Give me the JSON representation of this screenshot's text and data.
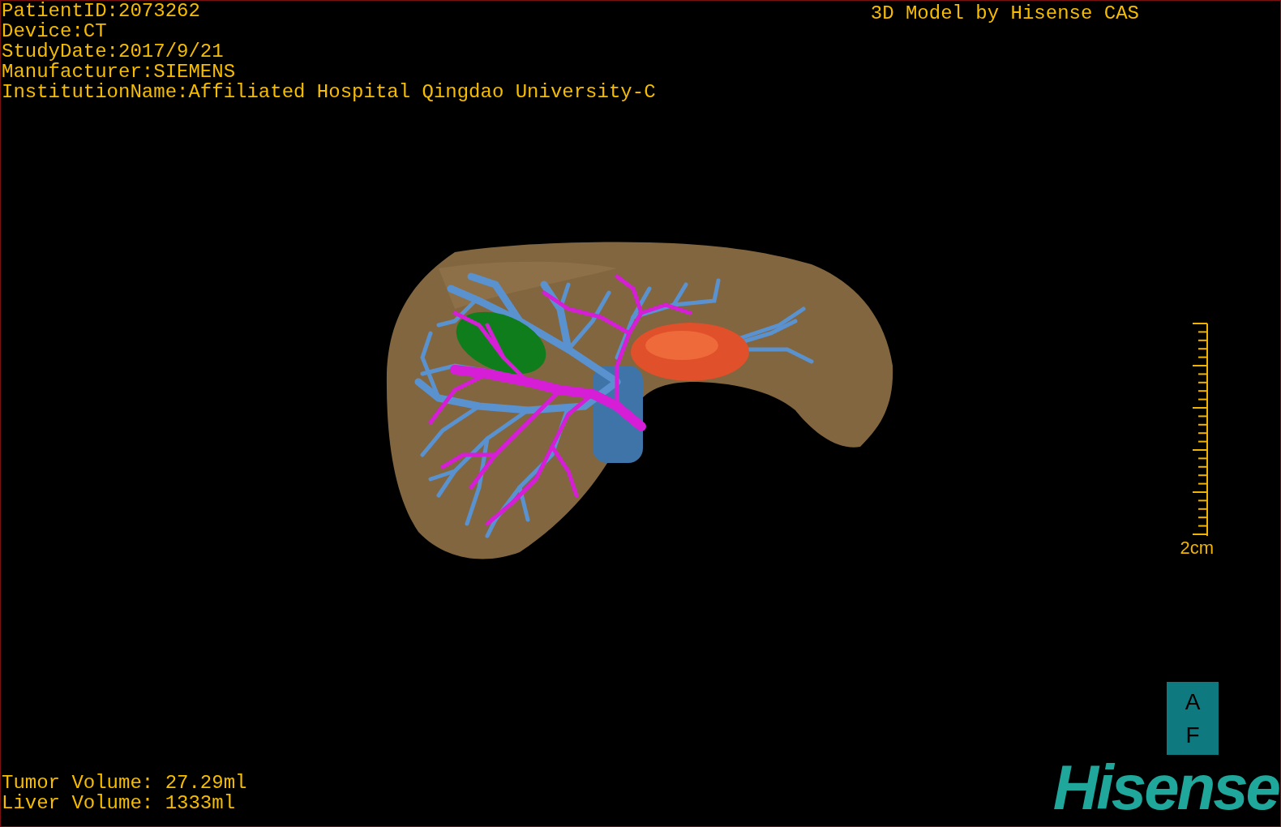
{
  "header": {
    "info_lines": [
      "PatientID:2073262",
      "Device:CT",
      "StudyDate:2017/9/21",
      "Manufacturer:SIEMENS",
      "InstitutionName:Affiliated Hospital Qingdao University-C"
    ],
    "title": "3D Model by Hisense CAS"
  },
  "scale_bar": {
    "label": "2cm"
  },
  "orientation_marker": {
    "top": "A",
    "bottom": "F"
  },
  "volumes": [
    "Tumor Volume: 27.29ml",
    "Liver Volume: 1333ml"
  ],
  "logo": "Hisense"
}
